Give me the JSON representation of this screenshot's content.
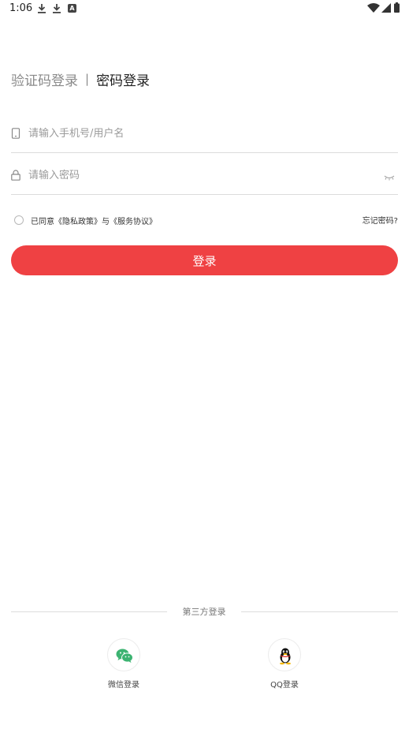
{
  "status_bar": {
    "time": "1:06"
  },
  "tabs": {
    "sms": "验证码登录",
    "divider": "|",
    "password": "密码登录"
  },
  "form": {
    "username_placeholder": "请输入手机号/用户名",
    "password_placeholder": "请输入密码"
  },
  "agreement": {
    "text": "已同意《隐私政策》与《服务协议》",
    "forgot": "忘记密码?"
  },
  "login_button": "登录",
  "third_party": {
    "title": "第三方登录",
    "wechat_label": "微信登录",
    "qq_label": "QQ登录"
  },
  "colors": {
    "accent": "#ef4143",
    "wechat": "#3cb371",
    "text_muted": "#9a9a9a"
  }
}
